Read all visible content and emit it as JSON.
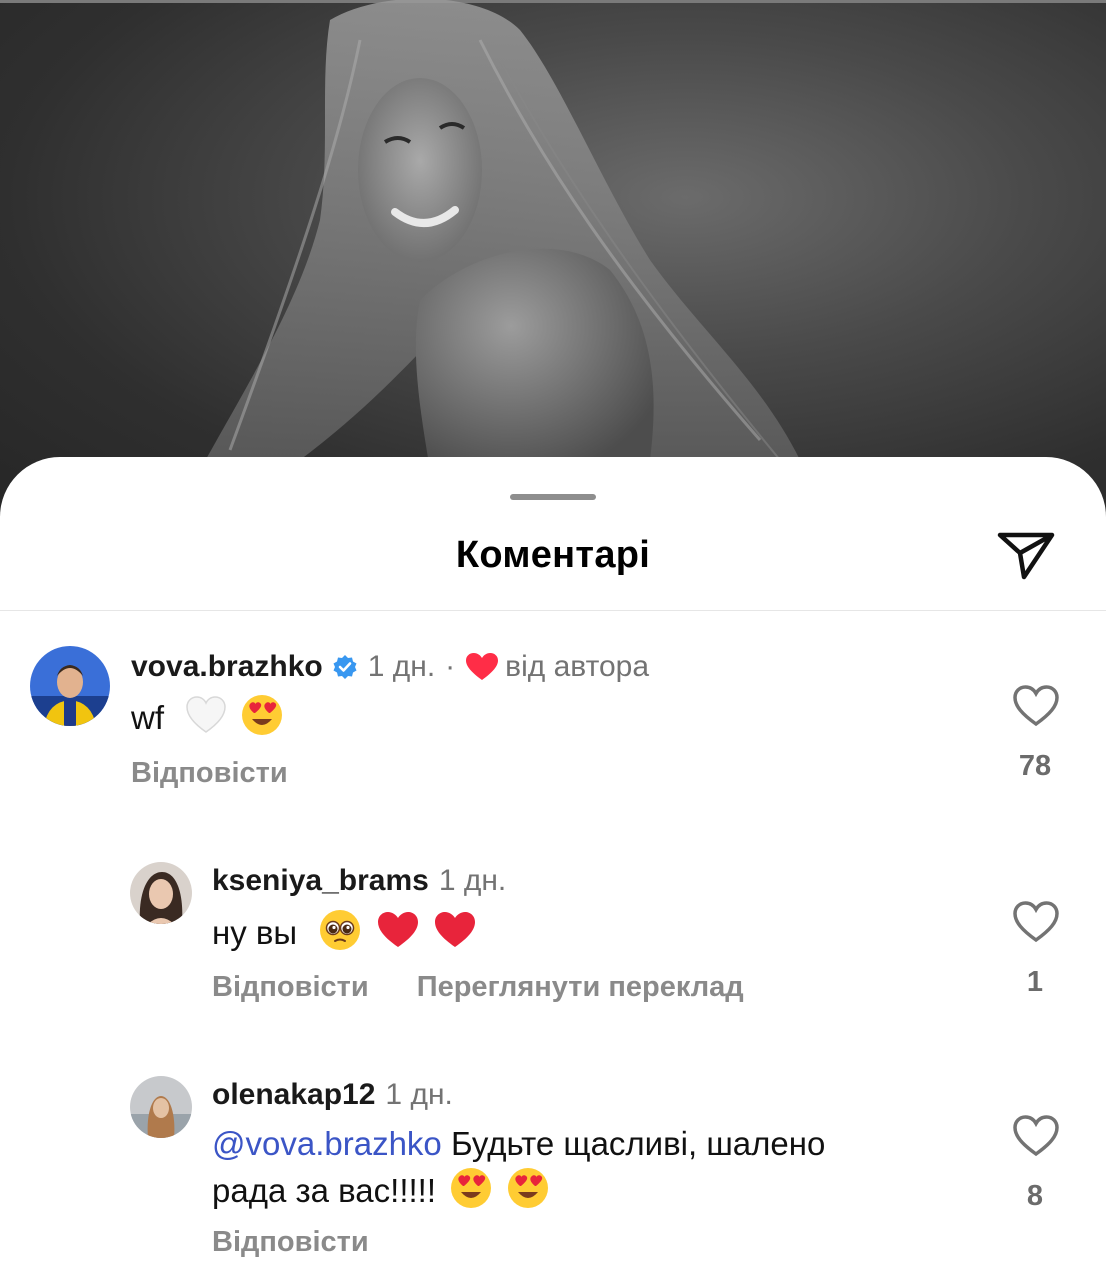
{
  "sheet": {
    "title": "Коментарі"
  },
  "comments": [
    {
      "username": "vova.brazhko",
      "verified": true,
      "time": "1 дн.",
      "separator": "·",
      "by_author": "від автора",
      "text": "wf",
      "emojis": [
        "white-heart",
        "heart-eyes"
      ],
      "reply_label": "Відповісти",
      "likes": "78"
    },
    {
      "username": "kseniya_brams",
      "time": "1 дн.",
      "text": "ну вы",
      "emojis": [
        "pleading-face",
        "red-heart",
        "red-heart"
      ],
      "reply_label": "Відповісти",
      "translate_label": "Переглянути переклад",
      "likes": "1"
    },
    {
      "username": "olenakap12",
      "time": "1 дн.",
      "mention": "@vova.brazhko",
      "text_line1": "Будьте щасливі, шалено",
      "text_line2": "рада за вас!!!!!",
      "emojis": [
        "heart-eyes",
        "heart-eyes"
      ],
      "reply_label": "Відповісти",
      "likes": "8"
    }
  ],
  "colors": {
    "accent_link": "#3b55c6",
    "verified": "#3897f0",
    "heart": "#ff2d47",
    "muted": "#737373"
  }
}
